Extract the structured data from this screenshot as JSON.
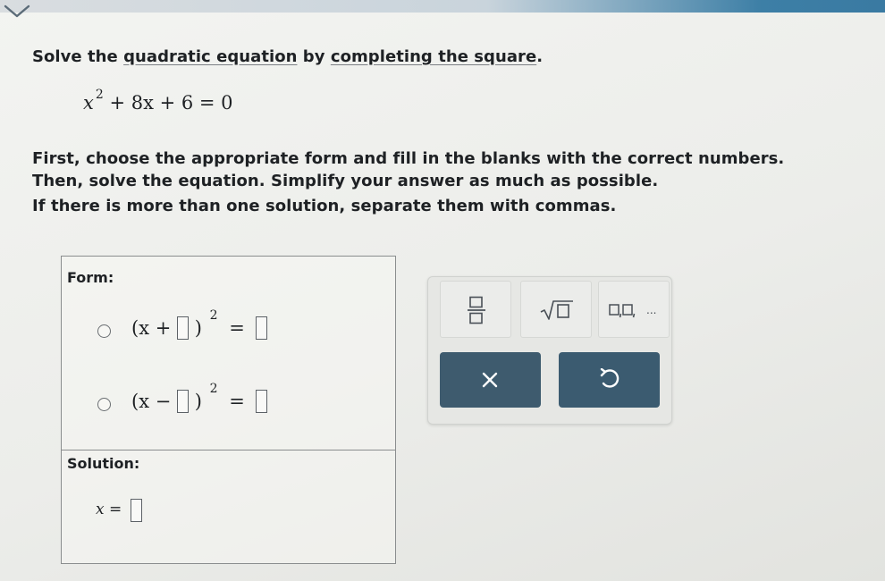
{
  "question": {
    "prompt_prefix": "Solve the ",
    "link_quadratic": "quadratic equation",
    "prompt_middle": " by ",
    "link_completing": "completing the square",
    "prompt_suffix": ".",
    "equation": {
      "x": "x",
      "exponent": "2",
      "rest": "+ 8x + 6 = 0"
    },
    "instructions": [
      "First, choose the appropriate form and fill in the blanks with the correct numbers.",
      "Then, solve the equation. Simplify your answer as much as possible.",
      "If there is more than one solution, separate them with commas."
    ]
  },
  "answer": {
    "form_label": "Form:",
    "options": [
      {
        "open": "(x +",
        "close": ")",
        "exponent": "2",
        "equals": "="
      },
      {
        "open": "(x −",
        "close": ")",
        "exponent": "2",
        "equals": "="
      }
    ],
    "solution_label": "Solution:",
    "solution_prefix": "x ="
  },
  "toolbox": {
    "list_suffix": "..."
  },
  "colors": {
    "action_button": "#3c5a6d",
    "accent_bar": "#3d7fa6"
  },
  "icons": [
    "chevron-down-icon",
    "fraction-icon",
    "square-root-icon",
    "list-icon",
    "close-icon",
    "undo-icon"
  ]
}
